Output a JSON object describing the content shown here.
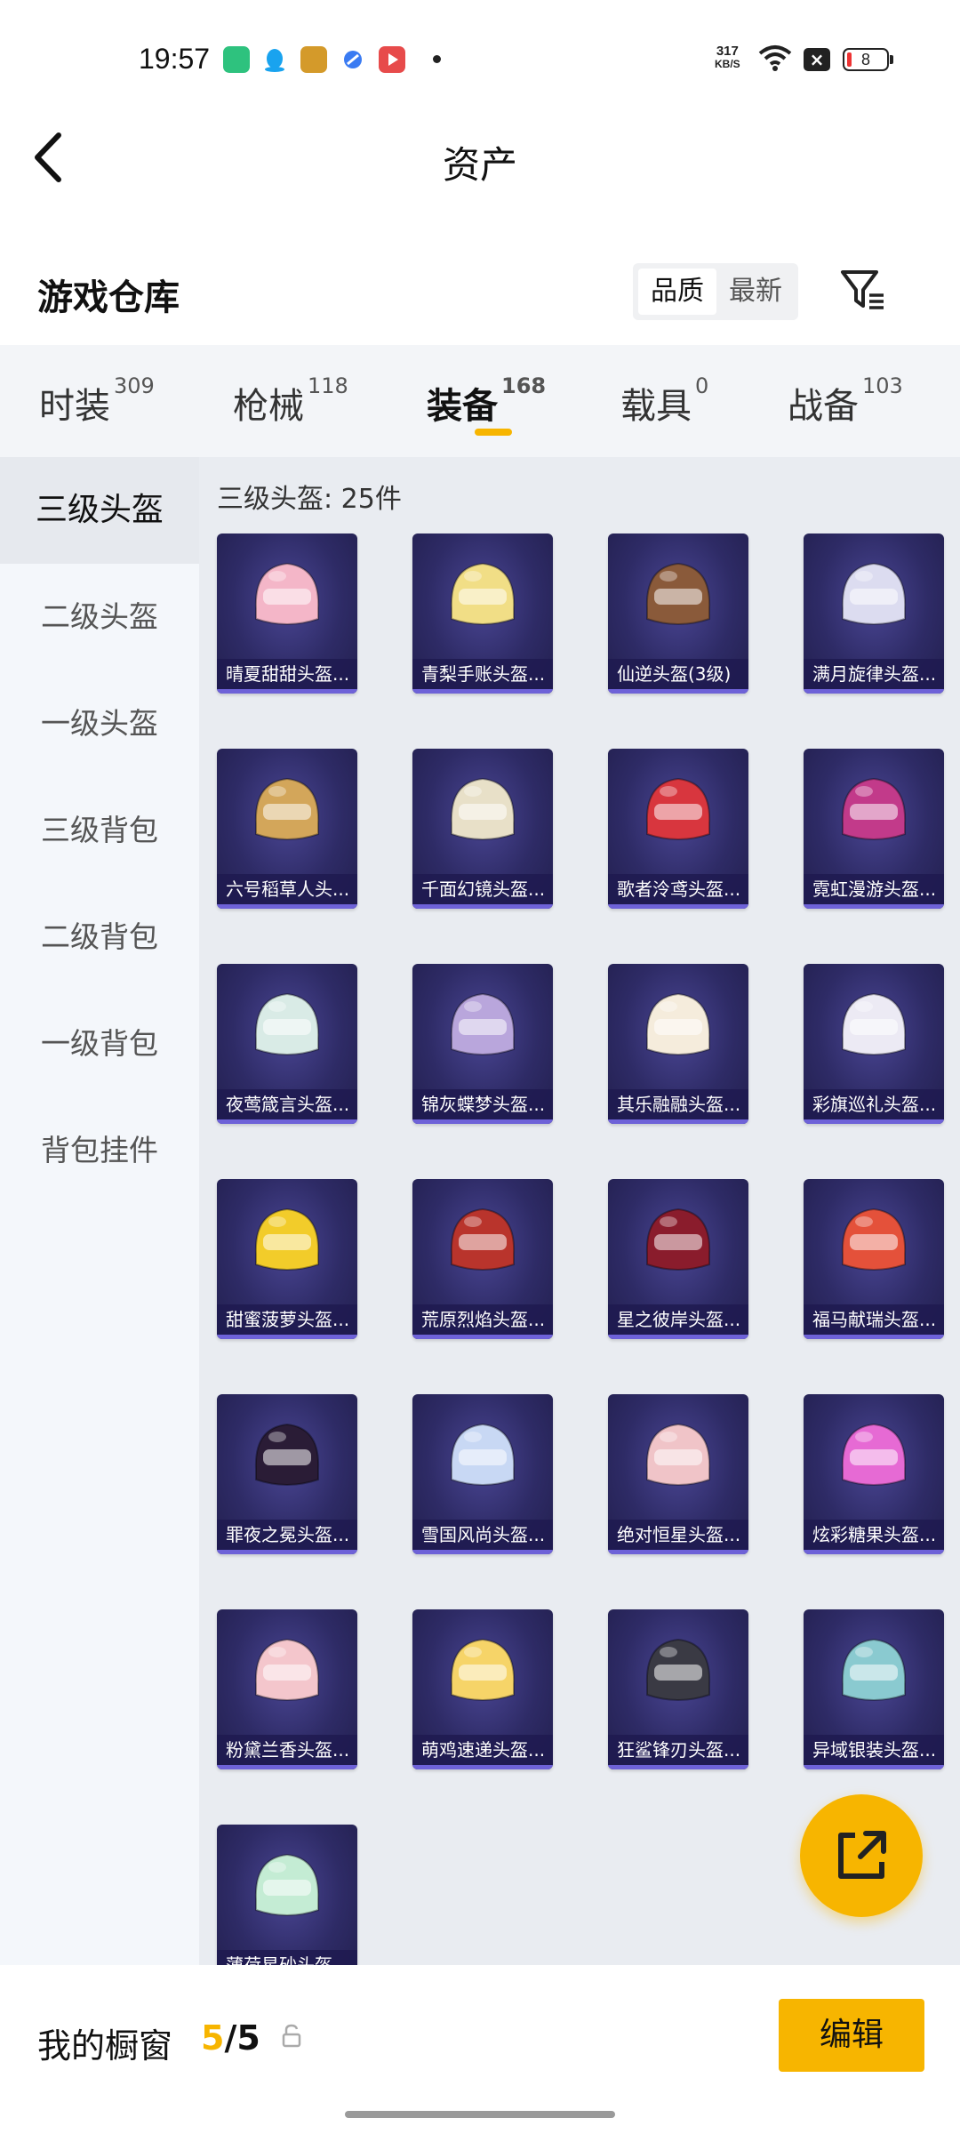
{
  "status_bar": {
    "time": "19:57",
    "net_speed_value": "317",
    "net_speed_unit": "KB/S",
    "battery": "8",
    "icons": [
      "app-green-icon",
      "qq-icon",
      "game-icon",
      "blue-app-icon",
      "video-app-icon",
      "wifi-icon",
      "x-icon",
      "battery-icon"
    ]
  },
  "header": {
    "title": "资产",
    "back_icon": "chevron-left-icon"
  },
  "section": {
    "title": "游戏仓库",
    "sort_options": [
      "品质",
      "最新"
    ],
    "sort_selected": "品质",
    "filter_icon": "filter-icon"
  },
  "tabs": [
    {
      "label": "时装",
      "count": "309"
    },
    {
      "label": "枪械",
      "count": "118"
    },
    {
      "label": "装备",
      "count": "168",
      "active": true
    },
    {
      "label": "载具",
      "count": "0"
    },
    {
      "label": "战备",
      "count": "103"
    }
  ],
  "sidebar": {
    "items": [
      "三级头盔",
      "二级头盔",
      "一级头盔",
      "三级背包",
      "二级背包",
      "一级背包",
      "背包挂件"
    ],
    "selected": "三级头盔"
  },
  "grid": {
    "count_label": "三级头盔: 25件",
    "items": [
      {
        "label": "晴夏甜甜头盔...",
        "color": "#f4b6c8"
      },
      {
        "label": "青梨手账头盔...",
        "color": "#f1de86"
      },
      {
        "label": "仙逆头盔(3级)",
        "color": "#8a5a3a"
      },
      {
        "label": "满月旋律头盔...",
        "color": "#dcdcf0"
      },
      {
        "label": "六号稻草人头...",
        "color": "#d3a65a"
      },
      {
        "label": "千面幻镜头盔...",
        "color": "#e8e0c8"
      },
      {
        "label": "歌者泠鸢头盔...",
        "color": "#d8363e"
      },
      {
        "label": "霓虹漫游头盔...",
        "color": "#c23a8a"
      },
      {
        "label": "夜莺箴言头盔...",
        "color": "#d9ebe6"
      },
      {
        "label": "锦灰蝶梦头盔...",
        "color": "#b9a6dc"
      },
      {
        "label": "其乐融融头盔...",
        "color": "#f5ecdc"
      },
      {
        "label": "彩旗巡礼头盔...",
        "color": "#eceaf4"
      },
      {
        "label": "甜蜜菠萝头盔...",
        "color": "#f2cc2a"
      },
      {
        "label": "荒原烈焰头盔...",
        "color": "#b9342c"
      },
      {
        "label": "星之彼岸头盔...",
        "color": "#8a1c2c"
      },
      {
        "label": "福马献瑞头盔...",
        "color": "#e4513a"
      },
      {
        "label": "罪夜之冕头盔...",
        "color": "#2a1c36"
      },
      {
        "label": "雪国风尚头盔...",
        "color": "#c8d8f4"
      },
      {
        "label": "绝对恒星头盔...",
        "color": "#f0c4c8"
      },
      {
        "label": "炫彩糖果头盔...",
        "color": "#e66ad4"
      },
      {
        "label": "粉黛兰香头盔...",
        "color": "#f4c6cc"
      },
      {
        "label": "萌鸡速递头盔...",
        "color": "#f6d468"
      },
      {
        "label": "狂鲨锋刃头盔...",
        "color": "#3a3a44"
      },
      {
        "label": "异域银装头盔...",
        "color": "#8acad0"
      },
      {
        "label": "薄荷星砂头盔...",
        "color": "#c4ecd4"
      }
    ]
  },
  "fab": {
    "icon": "share-external-icon"
  },
  "bottom": {
    "showcase_label": "我的橱窗",
    "showcase_current": "5",
    "showcase_total": "/5",
    "lock_icon": "lock-open-icon",
    "edit_label": "编辑"
  },
  "colors": {
    "accent": "#f7b500",
    "card_bg": "#2e2b66",
    "sidebar_bg": "#f4f7fb",
    "grid_bg": "#e9ecf1"
  }
}
